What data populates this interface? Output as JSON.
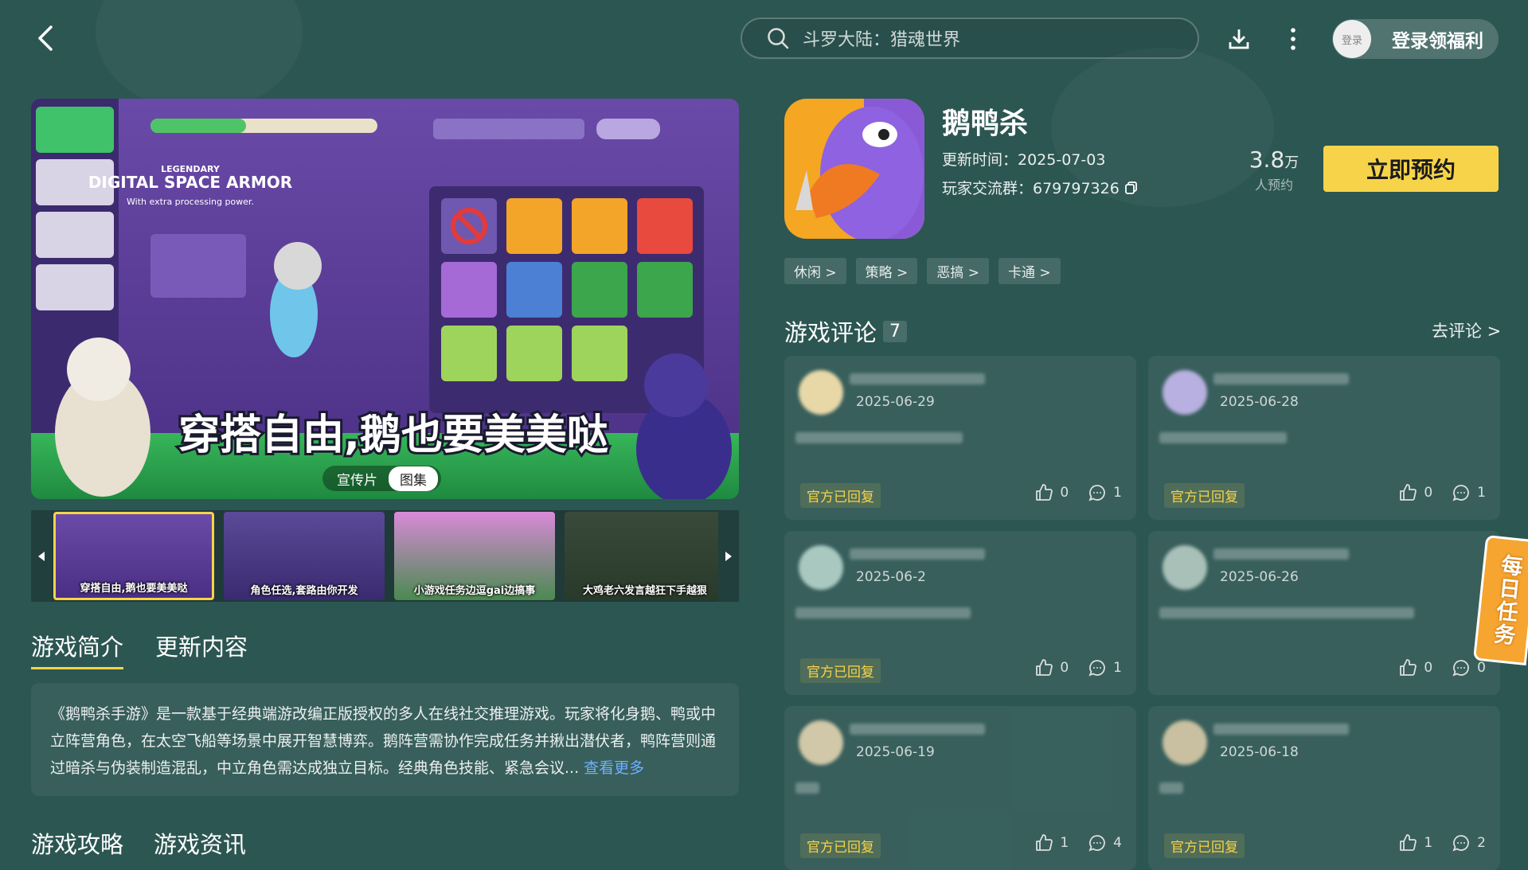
{
  "header": {
    "search_placeholder": "斗罗大陆：猎魂世界",
    "login_avatar": "登录",
    "login_label": "登录领福利"
  },
  "media": {
    "banner_text": "穿搭自由,鹅也要美美哒",
    "banner_en_title": "DIGITAL SPACE ARMOR",
    "banner_en_sub": "With extra processing power.",
    "banner_legendary": "LEGENDARY",
    "segments": [
      "宣传片",
      "图集"
    ],
    "thumbs": [
      "穿搭自由,鹅也要美美哒",
      "角色任选,套路由你开发",
      "小游戏任务边逗gai边搞事",
      "大鸡老六发言越狂下手越狠"
    ]
  },
  "tabs": [
    "游戏简介",
    "更新内容"
  ],
  "intro": {
    "text": "《鹅鸭杀手游》是一款基于经典端游改编正版授权的多人在线社交推理游戏。玩家将化身鹅、鸭或中立阵营角色，在太空飞船等场景中展开智慧博弈。鹅阵营需协作完成任务并揪出潜伏者，鸭阵营则通过暗杀与伪装制造混乱，中立角色需达成独立目标。经典角色技能、紧急会议...",
    "more": "查看更多"
  },
  "tabs2": [
    "游戏攻略",
    "游戏资讯"
  ],
  "app": {
    "name": "鹅鸭杀",
    "update": "更新时间：2025-07-03",
    "group": "玩家交流群：679797326",
    "stat_num": "3.8",
    "stat_unit": "万",
    "stat_label": "人预约",
    "reserve": "立即预约",
    "tags": [
      "休闲 >",
      "策略 >",
      "恶搞 >",
      "卡通 >"
    ]
  },
  "comments": {
    "title": "游戏评论",
    "count": "7",
    "go": "去评论 >",
    "items": [
      {
        "date": "2025-06-29",
        "badge": "官方已回复",
        "likes": "0",
        "replies": "1"
      },
      {
        "date": "2025-06-28",
        "badge": "官方已回复",
        "likes": "0",
        "replies": "1"
      },
      {
        "date": "2025-06-2",
        "badge": "官方已回复",
        "likes": "0",
        "replies": "1"
      },
      {
        "date": "2025-06-26",
        "badge": "",
        "likes": "0",
        "replies": "0"
      },
      {
        "date": "2025-06-19",
        "badge": "官方已回复",
        "likes": "1",
        "replies": "4"
      },
      {
        "date": "2025-06-18",
        "badge": "官方已回复",
        "likes": "1",
        "replies": "2"
      }
    ]
  },
  "daily_task": "每日任务"
}
